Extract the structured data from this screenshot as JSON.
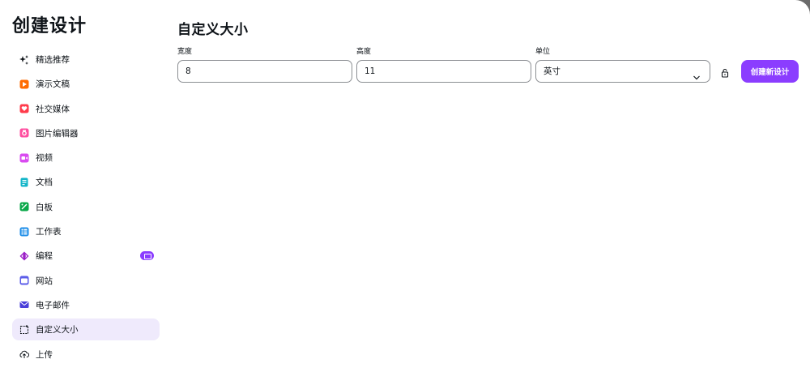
{
  "sidebar": {
    "title": "创建设计",
    "items": [
      {
        "label": "精选推荐"
      },
      {
        "label": "演示文稿"
      },
      {
        "label": "社交媒体"
      },
      {
        "label": "图片编辑器"
      },
      {
        "label": "视频"
      },
      {
        "label": "文档"
      },
      {
        "label": "白板"
      },
      {
        "label": "工作表"
      },
      {
        "label": "编程"
      },
      {
        "label": "网站"
      },
      {
        "label": "电子邮件"
      },
      {
        "label": "自定义大小"
      },
      {
        "label": "上传"
      }
    ]
  },
  "main": {
    "title": "自定义大小",
    "width_label": "宽度",
    "width_value": "8",
    "height_label": "高度",
    "height_value": "11",
    "unit_label": "单位",
    "unit_value": "英寸",
    "create_button": "创建新设计"
  },
  "colors": {
    "accent": "#8b3dff",
    "active_bg": "#efeafc"
  },
  "icons": [
    "sparkle-icon",
    "presentation-icon",
    "heart-icon",
    "camera-icon",
    "video-icon",
    "doc-icon",
    "whiteboard-icon",
    "sheet-icon",
    "code-icon",
    "website-icon",
    "email-icon",
    "custom-size-icon",
    "upload-icon",
    "lock-icon",
    "chevron-down-icon"
  ]
}
